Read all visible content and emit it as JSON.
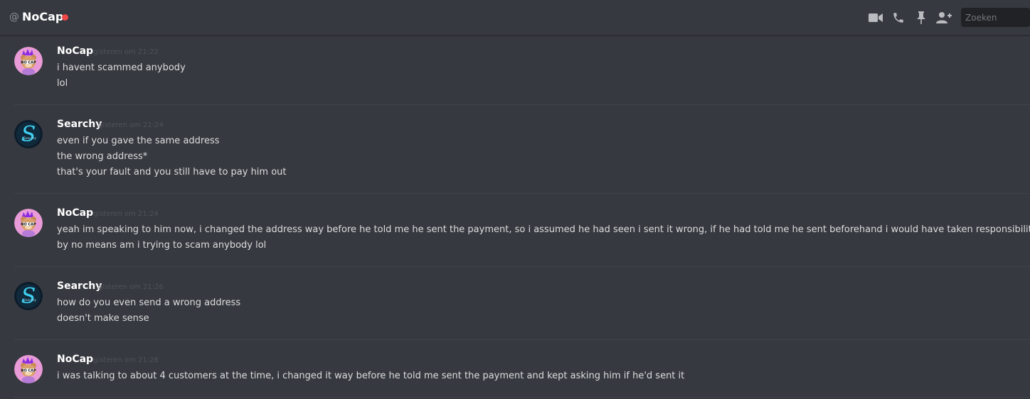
{
  "header": {
    "at_symbol": "@",
    "title": "NoCap",
    "status_color": "#f04747",
    "icons": [
      "video-call-icon",
      "voice-call-icon",
      "pin-icon",
      "add-friend-icon"
    ],
    "search_placeholder": "Zoeken"
  },
  "messages": [
    {
      "author": "NoCap",
      "timestamp": "gisteren om 21:22",
      "avatar": "nocap-bear-avatar",
      "lines": [
        "i havent scammed anybody",
        "lol"
      ]
    },
    {
      "author": "Searchy",
      "timestamp": "gisteren om 21:24",
      "avatar": "searchy-s-logo-avatar",
      "lines": [
        "even if you gave the same address",
        "the wrong address*",
        "that's your fault and you still have to pay him out"
      ]
    },
    {
      "author": "NoCap",
      "timestamp": "gisteren om 21:24",
      "avatar": "nocap-bear-avatar",
      "lines": [
        "yeah im speaking to him now, i changed the address way before he told me he sent the payment, so i assumed he had seen i sent it wrong, if he had told me he sent beforehand i would have taken responsibility for it",
        "by no means am i trying to scam anybody lol"
      ]
    },
    {
      "author": "Searchy",
      "timestamp": "gisteren om 21:26",
      "avatar": "searchy-s-logo-avatar",
      "lines": [
        "how do you even send a wrong address",
        "doesn't make sense"
      ]
    },
    {
      "author": "NoCap",
      "timestamp": "gisteren om 21:28",
      "avatar": "nocap-bear-avatar",
      "lines": [
        "i was talking to about 4 customers at the time, i changed it way before he told me sent the payment and kept asking him if he'd sent it"
      ]
    }
  ]
}
